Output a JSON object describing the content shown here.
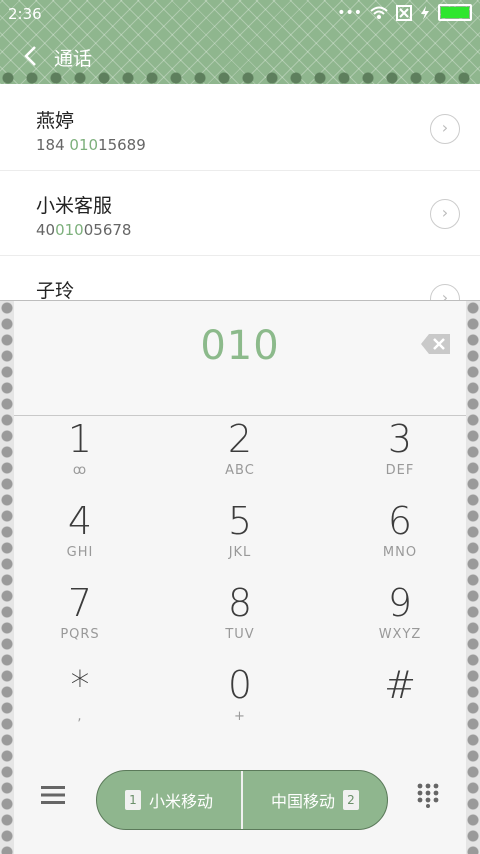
{
  "status": {
    "time": "2:36",
    "dots": "•••"
  },
  "header": {
    "title": "通话",
    "icons": {
      "back": "chevron-left-icon"
    }
  },
  "contacts": [
    {
      "name": "燕婷",
      "number_pre": "184 ",
      "number_hl": "010",
      "number_post": "15689"
    },
    {
      "name": "小米客服",
      "number_pre": "40",
      "number_hl": "010",
      "number_post": "05678"
    },
    {
      "name": "子玲",
      "number_pre": "",
      "number_hl": "",
      "number_post": ""
    }
  ],
  "dialpad": {
    "value": "010",
    "keys": [
      {
        "digit": "1",
        "letters": "ꝏ"
      },
      {
        "digit": "2",
        "letters": "ABC"
      },
      {
        "digit": "3",
        "letters": "DEF"
      },
      {
        "digit": "4",
        "letters": "GHI"
      },
      {
        "digit": "5",
        "letters": "JKL"
      },
      {
        "digit": "6",
        "letters": "MNO"
      },
      {
        "digit": "7",
        "letters": "PQRS"
      },
      {
        "digit": "8",
        "letters": "TUV"
      },
      {
        "digit": "9",
        "letters": "WXYZ"
      },
      {
        "digit": "*",
        "letters": ","
      },
      {
        "digit": "0",
        "letters": "+"
      },
      {
        "digit": "#",
        "letters": ""
      }
    ],
    "sim1": {
      "badge": "1",
      "label": "小米移动"
    },
    "sim2": {
      "label": "中国移动",
      "badge": "2"
    }
  },
  "colors": {
    "accent": "#8fb68e",
    "highlight": "#7db07c"
  }
}
